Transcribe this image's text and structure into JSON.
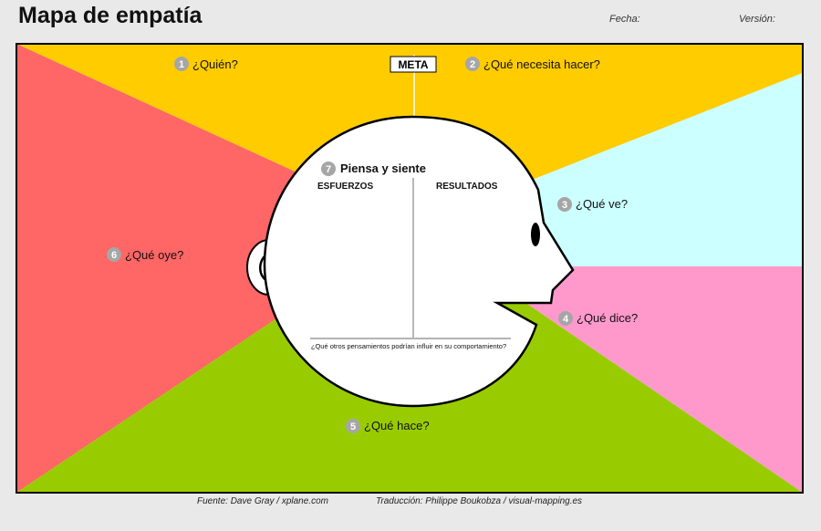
{
  "page": {
    "title": "Mapa de empatía",
    "date_label": "Fecha:",
    "version_label": "Versión:"
  },
  "colors": {
    "who_needs": "#ffcc00",
    "sees": "#ccffff",
    "says": "#ff99cc",
    "does": "#99cc00",
    "hears": "#ff6666",
    "head": "#ffffff",
    "badge": "#a6a6a6"
  },
  "sections": {
    "who": {
      "number": "1",
      "label": "¿Quién?"
    },
    "goal": {
      "label": "META"
    },
    "needs": {
      "number": "2",
      "label": "¿Qué necesita hacer?"
    },
    "sees": {
      "number": "3",
      "label": "¿Qué ve?"
    },
    "says": {
      "number": "4",
      "label": "¿Qué dice?"
    },
    "does": {
      "number": "5",
      "label": "¿Qué hace?"
    },
    "hears": {
      "number": "6",
      "label": "¿Qué oye?"
    },
    "thinks": {
      "number": "7",
      "label": "Piensa y siente",
      "left_column": "ESFUERZOS",
      "right_column": "RESULTADOS",
      "question": "¿Qué otros pensamientos podrían influir en su comportamiento?"
    }
  },
  "footer": {
    "source": "Fuente: Dave Gray / xplane.com",
    "translation": "Traducción: Philippe Boukobza / visual-mapping.es"
  }
}
